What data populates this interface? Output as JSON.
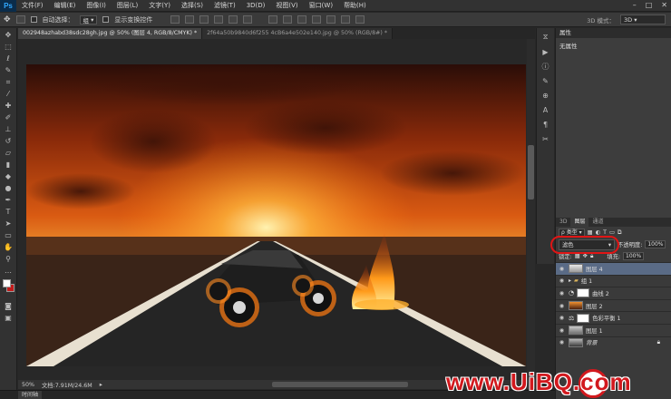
{
  "app": {
    "logo": "Ps"
  },
  "menu": [
    "文件(F)",
    "编辑(E)",
    "图像(I)",
    "图层(L)",
    "文字(Y)",
    "选择(S)",
    "滤镜(T)",
    "3D(D)",
    "视图(V)",
    "窗口(W)",
    "帮助(H)"
  ],
  "window_controls": [
    "–",
    "□",
    "✕"
  ],
  "options": {
    "auto_select_label": "自动选择：",
    "auto_select_value": "组",
    "transform_label": "显示变换控件",
    "mode_3d_label": "3D 模式：",
    "workspace": "3D"
  },
  "tabs": [
    {
      "label": "002948azhabd38sdc28gh.jpg @ 50% (图层 4, RGB/8/CMYK) *",
      "active": true
    },
    {
      "label": "2f64a50b9840d6f255 4cB6a4e502e140.jpg @ 50% (RGB/8#) *",
      "active": false
    }
  ],
  "status": {
    "zoom": "50%",
    "doc": "文档:7.91M/24.6M"
  },
  "timeline_tab": "时间轴",
  "properties": {
    "title": "属性",
    "content": "无属性"
  },
  "layers_panel": {
    "tabs": [
      "3D",
      "图层",
      "通道"
    ],
    "filter_kind": "ρ 类型",
    "blend_mode": "滤色",
    "opacity_label": "不透明度:",
    "opacity_value": "100%",
    "lock_label": "锁定:",
    "fill_label": "填充:",
    "fill_value": "100%",
    "layers": [
      {
        "name": "图层 4",
        "selected": true
      },
      {
        "name": "组 1",
        "selected": false
      },
      {
        "name": "曲线 2",
        "selected": false
      },
      {
        "name": "图层 2",
        "selected": false
      },
      {
        "name": "色彩平衡 1",
        "selected": false
      },
      {
        "name": "图层 1",
        "selected": false
      },
      {
        "name": "背景",
        "selected": false
      }
    ]
  },
  "watermark": "www.UiBQ.com",
  "colors": {
    "accent_red": "#d2191e",
    "selected_layer": "#5a6b86",
    "ps_blue": "#31a8ff"
  }
}
